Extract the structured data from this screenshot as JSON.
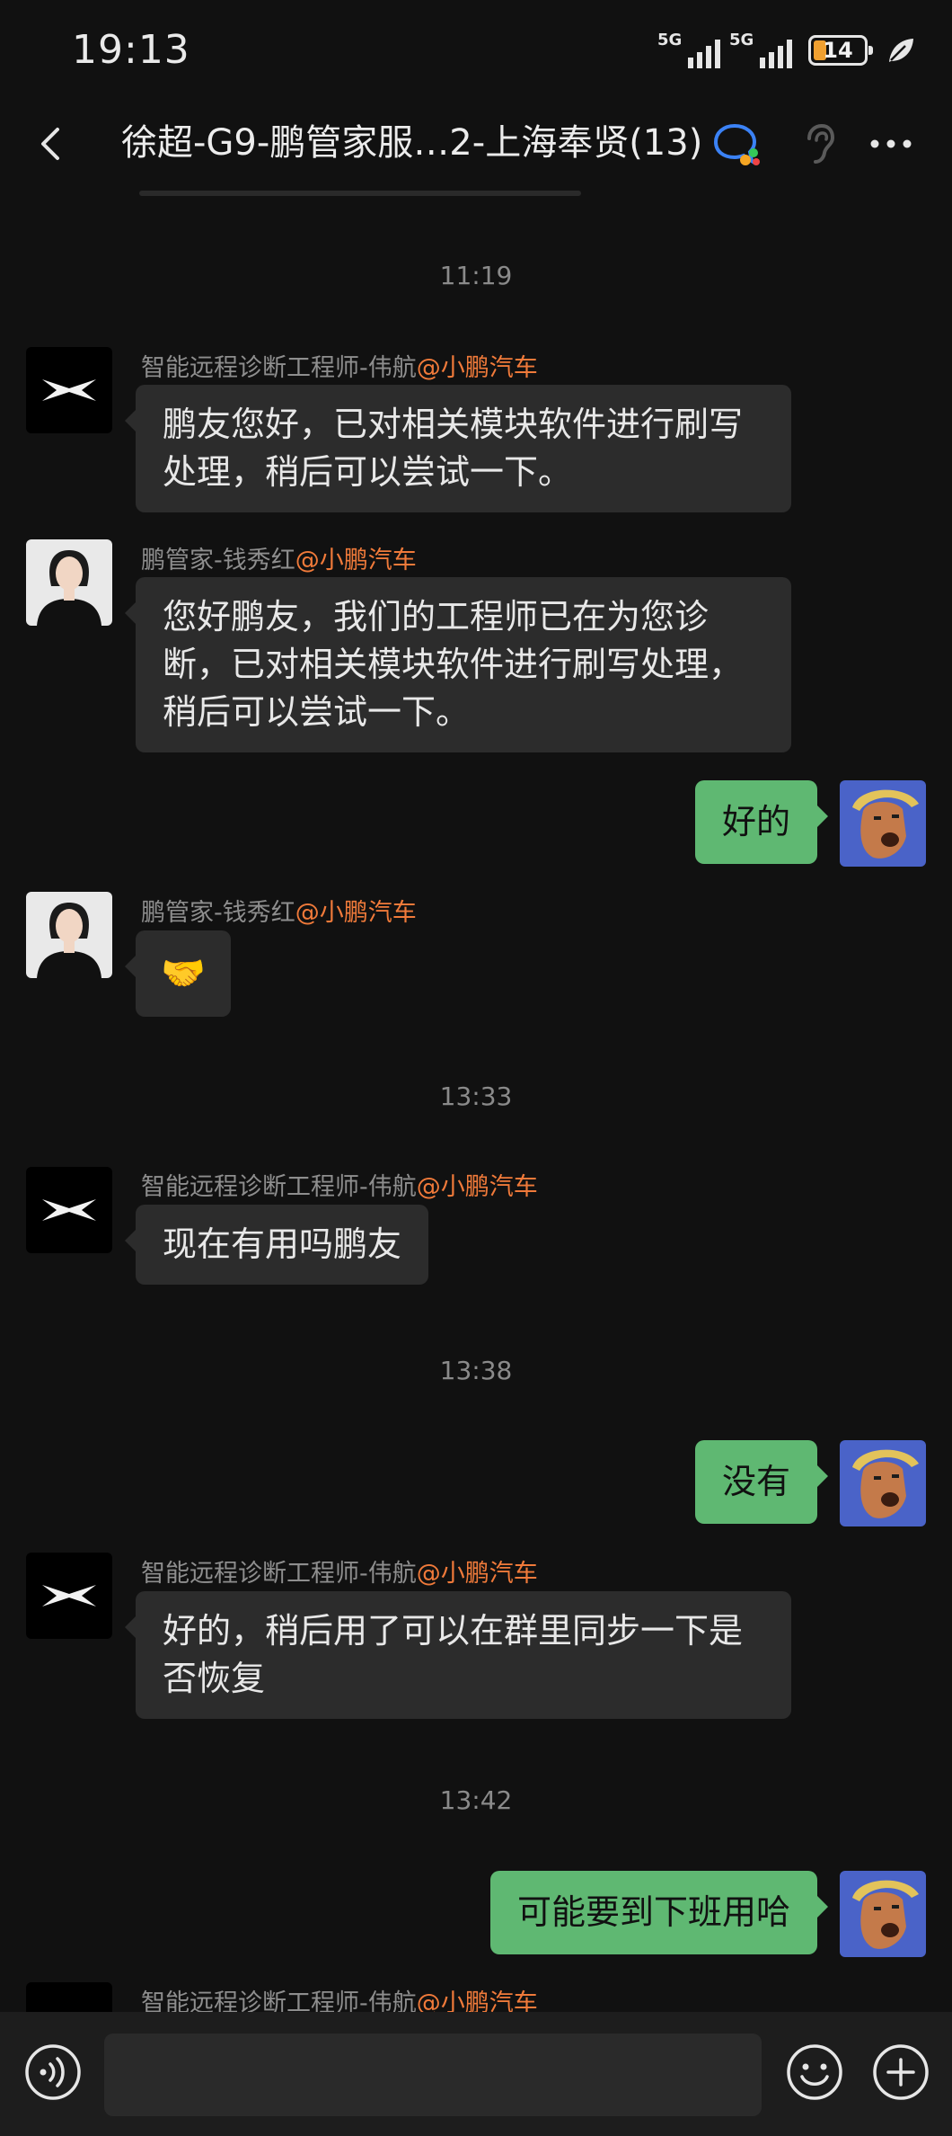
{
  "status_bar": {
    "time": "19:13",
    "network_1": "5G",
    "network_2": "5G",
    "battery": "14"
  },
  "header": {
    "title": "徐超-G9-鹏管家服…2-上海奉贤(13)"
  },
  "messages": {
    "t1": "11:19",
    "m1": {
      "sender": "智能远程诊断工程师-伟航",
      "org": "@小鹏汽车",
      "text": "鹏友您好，已对相关模块软件进行刷写处理，稍后可以尝试一下。"
    },
    "m2": {
      "sender": "鹏管家-钱秀红",
      "org": "@小鹏汽车",
      "text": "您好鹏友，我们的工程师已在为您诊断，已对相关模块软件进行刷写处理，稍后可以尝试一下。"
    },
    "m3": {
      "text": "好的"
    },
    "m4": {
      "sender": "鹏管家-钱秀红",
      "org": "@小鹏汽车",
      "emoji": "🤝"
    },
    "t2": "13:33",
    "m5": {
      "sender": "智能远程诊断工程师-伟航",
      "org": "@小鹏汽车",
      "text": "现在有用吗鹏友"
    },
    "t3": "13:38",
    "m6": {
      "text": "没有"
    },
    "m7": {
      "sender": "智能远程诊断工程师-伟航",
      "org": "@小鹏汽车",
      "text": "好的，稍后用了可以在群里同步一下是否恢复"
    },
    "t4": "13:42",
    "m8": {
      "text": "可能要到下班用哈"
    },
    "m9": {
      "sender": "智能远程诊断工程师-伟航",
      "org": "@小鹏汽车"
    }
  },
  "colors": {
    "background": "#111111",
    "incoming_bubble": "#2c2c2c",
    "outgoing_bubble": "#5fb872",
    "org_accent": "#f07a3a",
    "battery_fill": "#f0a030"
  },
  "icons": [
    "back-arrow-icon",
    "group-chat-icon",
    "ear-icon",
    "more-icon",
    "voice-icon",
    "emoji-icon",
    "plus-icon",
    "leaf-icon"
  ]
}
